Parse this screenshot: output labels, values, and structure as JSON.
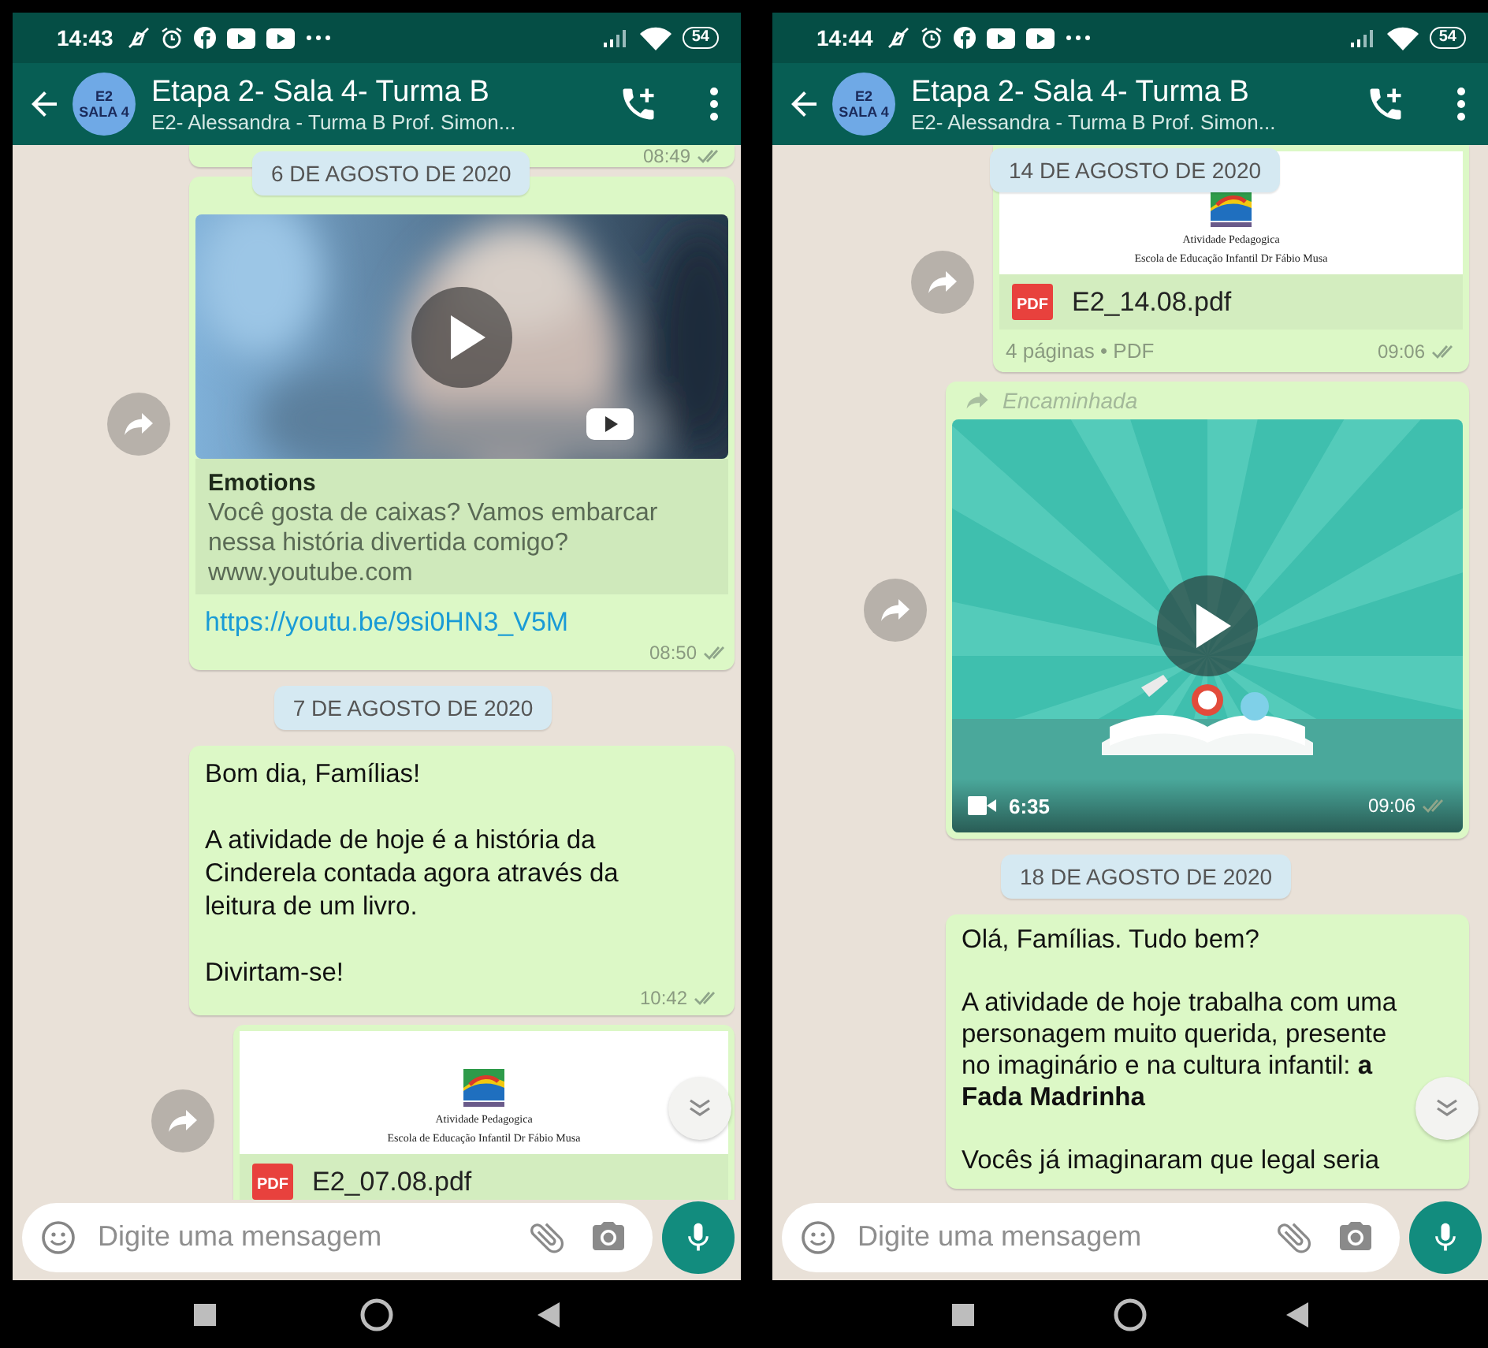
{
  "phones": [
    {
      "status_bar": {
        "time": "14:43",
        "battery": "54"
      },
      "header": {
        "avatar_lines": [
          "E2",
          "SALA 4"
        ],
        "title": "Etapa 2- Sala 4- Turma B",
        "subtitle": "E2- Alessandra - Turma B Prof. Simon..."
      },
      "floating_date": "6 DE AGOSTO DE 2020",
      "messages": [
        {
          "kind": "tail",
          "time": "08:49",
          "read": false
        },
        {
          "kind": "link",
          "share_button": true,
          "preview_title": "Emotions",
          "preview_text": "Você gosta de caixas? Vamos embarcar nessa história divertida comigo?",
          "preview_domain": "www.youtube.com",
          "link": "https://youtu.be/9si0HN3_V5M",
          "time": "08:50",
          "read": false
        },
        {
          "kind": "date",
          "text": "7 DE AGOSTO DE 2020"
        },
        {
          "kind": "text",
          "text": "Bom dia, Famílias!\n\nA atividade de hoje é a história da Cinderela contada agora através da leitura de um livro.\n\nDivirtam-se!",
          "time": "10:42",
          "read": false
        },
        {
          "kind": "document",
          "share_button": true,
          "doc_lines": [
            "Atividade Pedagogica",
            "Escola de Educação Infantil Dr Fábio Musa"
          ],
          "file_type": "PDF",
          "file_name": "E2_07.08.pdf"
        }
      ],
      "composer": {
        "placeholder": "Digite uma mensagem"
      }
    },
    {
      "status_bar": {
        "time": "14:44",
        "battery": "54"
      },
      "header": {
        "avatar_lines": [
          "E2",
          "SALA 4"
        ],
        "title": "Etapa 2- Sala 4- Turma B",
        "subtitle": "E2- Alessandra - Turma B Prof. Simon..."
      },
      "floating_date": "14 DE AGOSTO DE 2020",
      "messages": [
        {
          "kind": "document",
          "share_button": true,
          "doc_lines": [
            "Atividade Pedagogica",
            "Escola de Educação Infantil Dr Fábio Musa"
          ],
          "file_type": "PDF",
          "file_name": "E2_14.08.pdf",
          "meta": "4 páginas • PDF",
          "time": "09:06",
          "read": false
        },
        {
          "kind": "video",
          "share_button": true,
          "forwarded_label": "Encaminhada",
          "duration": "6:35",
          "time": "09:06",
          "read": false
        },
        {
          "kind": "date",
          "text": "18 DE AGOSTO DE 2020"
        },
        {
          "kind": "text",
          "text": "Olá, Famílias. Tudo bem?\n\nA atividade de hoje trabalha com uma personagem muito querida, presente no imaginário e na cultura infantil: **a Fada Madrinha**\n\nVocês já imaginaram que legal seria"
        }
      ],
      "composer": {
        "placeholder": "Digite uma mensagem"
      }
    }
  ]
}
